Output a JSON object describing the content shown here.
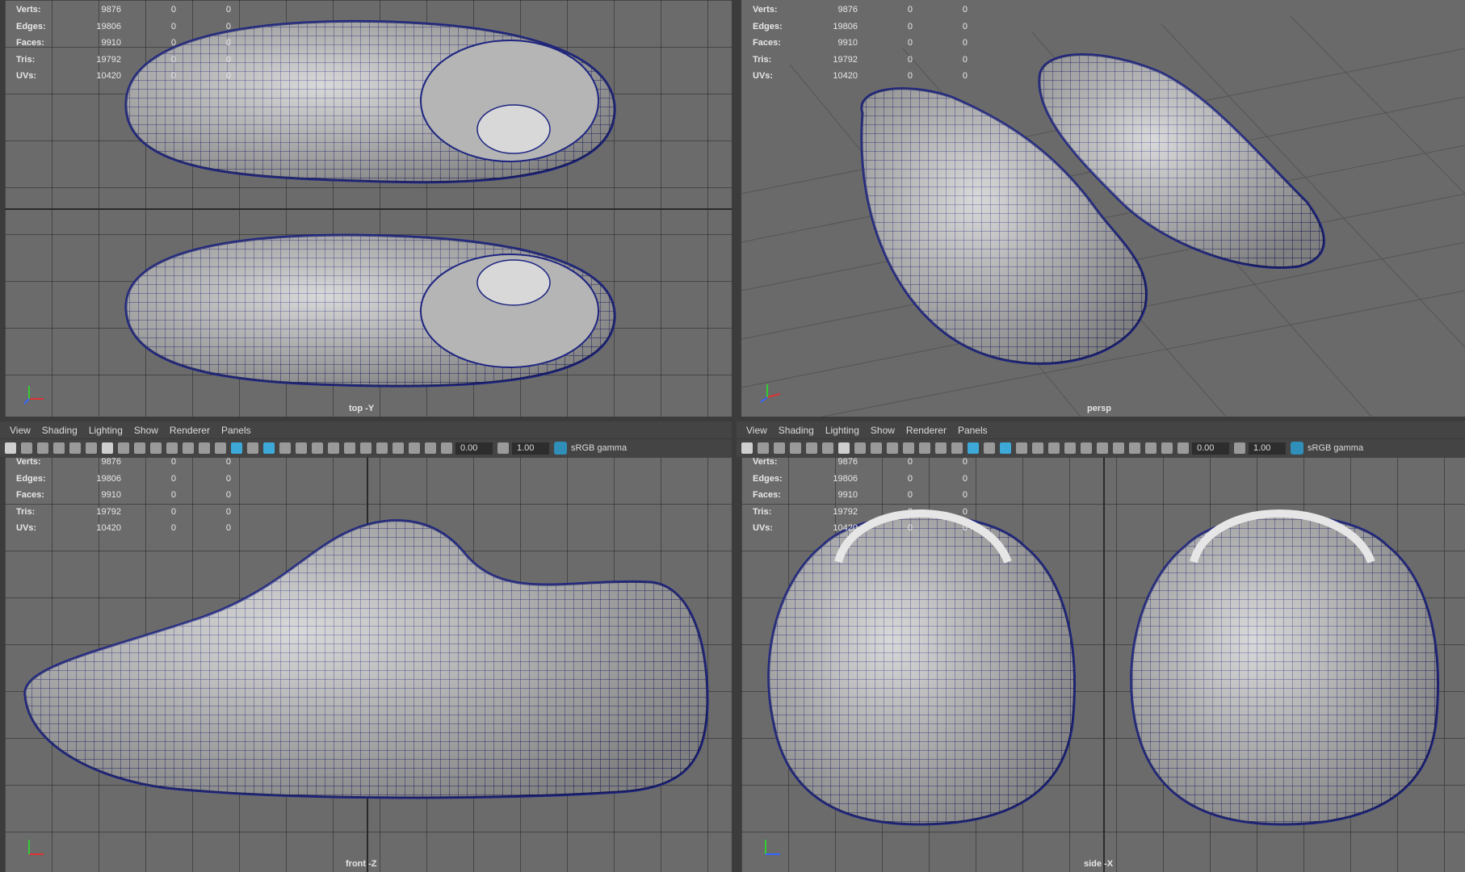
{
  "hud_labels": [
    "Verts:",
    "Edges:",
    "Faces:",
    "Tris:",
    "UVs:"
  ],
  "hud_values": [
    "9876",
    "19806",
    "9910",
    "19792",
    "10420"
  ],
  "hud_zero": "0",
  "panels": {
    "top": "top -Y",
    "persp": "persp",
    "front": "front -Z",
    "side": "side -X"
  },
  "menu": [
    "View",
    "Shading",
    "Lighting",
    "Show",
    "Renderer",
    "Panels"
  ],
  "toolbar": {
    "field1": "0.00",
    "field2": "1.00",
    "colorspace": "sRGB gamma"
  },
  "colors": {
    "wire": "#1d2480",
    "shoe": "#c6c6c6",
    "accent": "#3da9d9"
  }
}
